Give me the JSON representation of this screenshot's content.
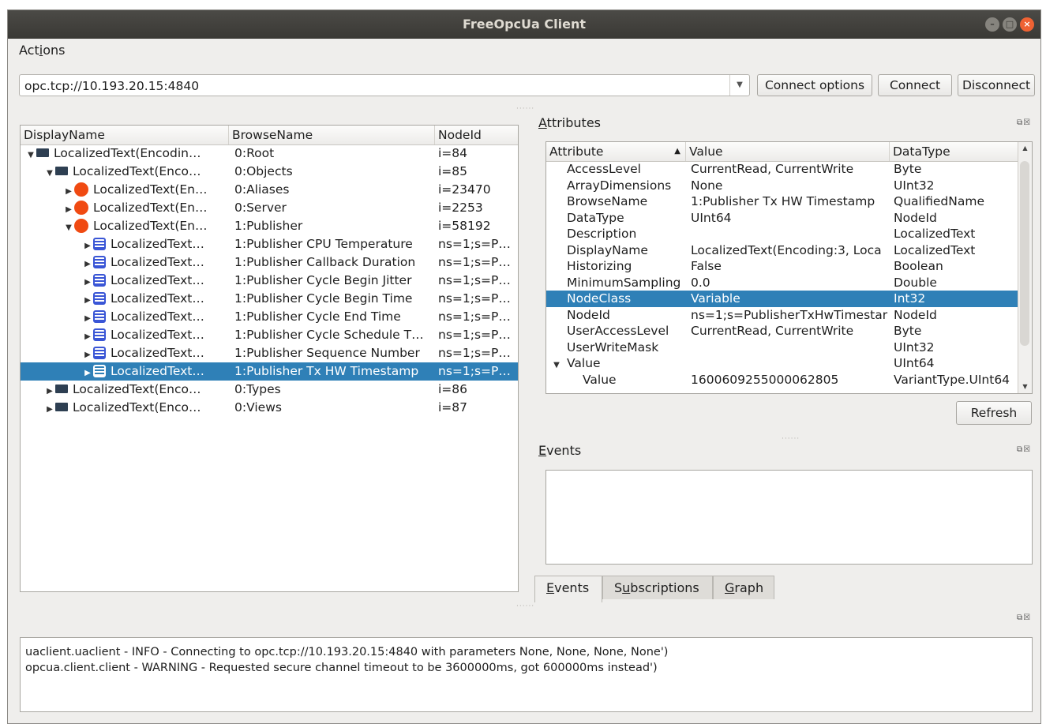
{
  "window": {
    "title": "FreeOpcUa Client"
  },
  "menu": {
    "actions_prefix": "Act",
    "actions_underline": "i",
    "actions_suffix": "ons"
  },
  "connection": {
    "address": "opc.tcp://10.193.20.15:4840",
    "connect_options_label": "Connect options",
    "connect_label": "Connect",
    "disconnect_label": "Disconnect"
  },
  "tree": {
    "columns": [
      "DisplayName",
      "BrowseName",
      "NodeId"
    ],
    "rows": [
      {
        "indent": 0,
        "arrow": "down",
        "icon": "folder-icon",
        "display": "LocalizedText(Encodin…",
        "browse": "0:Root",
        "nodeid": "i=84"
      },
      {
        "indent": 1,
        "arrow": "down",
        "icon": "folder-icon",
        "display": "LocalizedText(Enco…",
        "browse": "0:Objects",
        "nodeid": "i=85"
      },
      {
        "indent": 2,
        "arrow": "right",
        "icon": "object-icon",
        "display": "LocalizedText(En…",
        "browse": "0:Aliases",
        "nodeid": "i=23470"
      },
      {
        "indent": 2,
        "arrow": "right",
        "icon": "object-icon",
        "display": "LocalizedText(En…",
        "browse": "0:Server",
        "nodeid": "i=2253"
      },
      {
        "indent": 2,
        "arrow": "down",
        "icon": "object-icon",
        "display": "LocalizedText(En…",
        "browse": "1:Publisher",
        "nodeid": "i=58192"
      },
      {
        "indent": 3,
        "arrow": "right",
        "icon": "variable-icon",
        "display": "LocalizedText…",
        "browse": "1:Publisher CPU Temperature",
        "nodeid": "ns=1;s=P…"
      },
      {
        "indent": 3,
        "arrow": "right",
        "icon": "variable-icon",
        "display": "LocalizedText…",
        "browse": "1:Publisher Callback Duration",
        "nodeid": "ns=1;s=P…"
      },
      {
        "indent": 3,
        "arrow": "right",
        "icon": "variable-icon",
        "display": "LocalizedText…",
        "browse": "1:Publisher Cycle Begin Jitter",
        "nodeid": "ns=1;s=P…"
      },
      {
        "indent": 3,
        "arrow": "right",
        "icon": "variable-icon",
        "display": "LocalizedText…",
        "browse": "1:Publisher Cycle Begin Time",
        "nodeid": "ns=1;s=P…"
      },
      {
        "indent": 3,
        "arrow": "right",
        "icon": "variable-icon",
        "display": "LocalizedText…",
        "browse": "1:Publisher Cycle End Time",
        "nodeid": "ns=1;s=P…"
      },
      {
        "indent": 3,
        "arrow": "right",
        "icon": "variable-icon",
        "display": "LocalizedText…",
        "browse": "1:Publisher Cycle Schedule T…",
        "nodeid": "ns=1;s=P…"
      },
      {
        "indent": 3,
        "arrow": "right",
        "icon": "variable-icon",
        "display": "LocalizedText…",
        "browse": "1:Publisher Sequence Number",
        "nodeid": "ns=1;s=P…"
      },
      {
        "indent": 3,
        "arrow": "right",
        "icon": "variable-icon",
        "display": "LocalizedText…",
        "browse": "1:Publisher Tx HW Timestamp",
        "nodeid": "ns=1;s=P…",
        "selected": true
      },
      {
        "indent": 1,
        "arrow": "right",
        "icon": "folder-icon",
        "display": "LocalizedText(Enco…",
        "browse": "0:Types",
        "nodeid": "i=86"
      },
      {
        "indent": 1,
        "arrow": "right",
        "icon": "folder-icon",
        "display": "LocalizedText(Enco…",
        "browse": "0:Views",
        "nodeid": "i=87"
      }
    ]
  },
  "attributes": {
    "title_prefix": "",
    "title_underline": "A",
    "title_suffix": "ttributes",
    "columns": [
      "Attribute",
      "Value",
      "DataType"
    ],
    "sort_indicator": "▲",
    "rows": [
      {
        "attr": "AccessLevel",
        "value": "CurrentRead, CurrentWrite",
        "type": "Byte"
      },
      {
        "attr": "ArrayDimensions",
        "value": "None",
        "type": "UInt32"
      },
      {
        "attr": "BrowseName",
        "value": "1:Publisher Tx HW Timestamp",
        "type": "QualifiedName"
      },
      {
        "attr": "DataType",
        "value": "UInt64",
        "type": "NodeId"
      },
      {
        "attr": "Description",
        "value": "",
        "type": "LocalizedText"
      },
      {
        "attr": "DisplayName",
        "value": "LocalizedText(Encoding:3, Loca",
        "type": "LocalizedText"
      },
      {
        "attr": "Historizing",
        "value": "False",
        "type": "Boolean"
      },
      {
        "attr": "MinimumSampling",
        "value": "0.0",
        "type": "Double"
      },
      {
        "attr": "NodeClass",
        "value": "Variable",
        "type": "Int32",
        "selected": true
      },
      {
        "attr": "NodeId",
        "value": "ns=1;s=PublisherTxHwTimestar",
        "type": "NodeId"
      },
      {
        "attr": "UserAccessLevel",
        "value": "CurrentRead, CurrentWrite",
        "type": "Byte"
      },
      {
        "attr": "UserWriteMask",
        "value": "",
        "type": "UInt32"
      },
      {
        "attr": "Value",
        "value": "",
        "type": "UInt64",
        "expander": true
      },
      {
        "attr": "Value",
        "value": "1600609255000062805",
        "type": "VariantType.UInt64",
        "child": true
      }
    ],
    "refresh_label": "Refresh"
  },
  "events": {
    "title_prefix": "",
    "title_underline": "E",
    "title_suffix": "vents"
  },
  "tabs": [
    {
      "prefix": "",
      "u": "E",
      "suffix": "vents",
      "active": true
    },
    {
      "prefix": "S",
      "u": "u",
      "suffix": "bscriptions",
      "active": false
    },
    {
      "prefix": "",
      "u": "G",
      "suffix": "raph",
      "active": false
    }
  ],
  "log": {
    "lines": [
      "uaclient.uaclient - INFO - Connecting to opc.tcp://10.193.20.15:4840 with parameters None, None, None, None')",
      "opcua.client.client - WARNING - Requested secure channel timeout to be 3600000ms, got 600000ms instead')"
    ]
  },
  "colors": {
    "selection": "#2f80b7",
    "object_icon": "#f04a12",
    "variable_icon": "#3a56d6",
    "titlebar": "#3c3b37",
    "close_button": "#ef6233"
  }
}
